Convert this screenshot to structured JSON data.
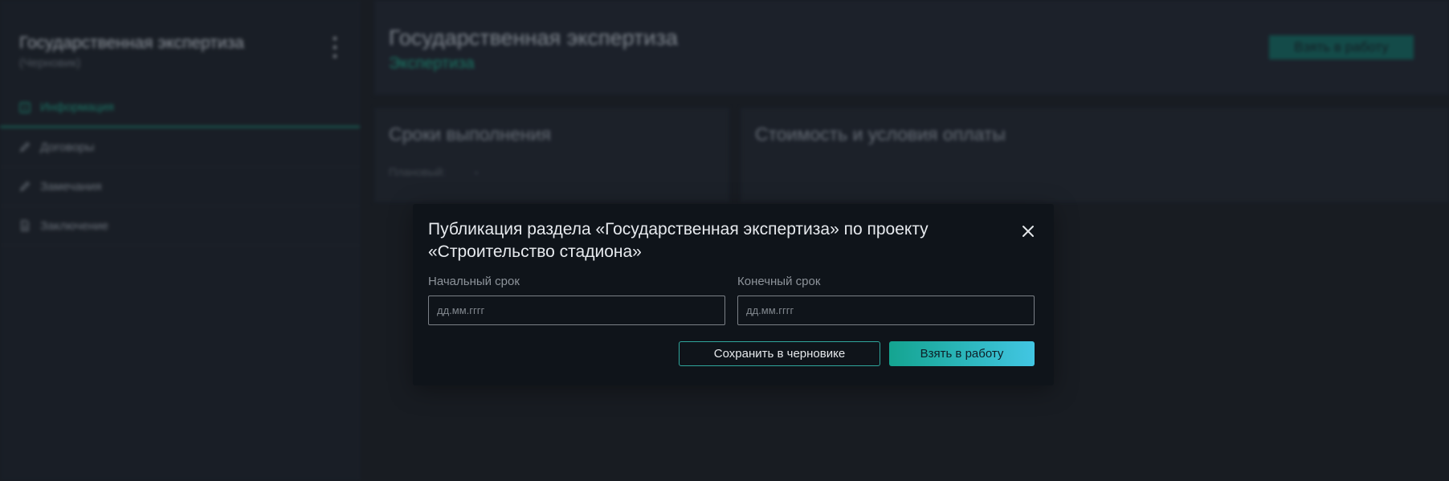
{
  "sidebar": {
    "title": "Государственная экспертиза",
    "subtitle": "(Черновик)",
    "items": [
      {
        "label": "Информация",
        "icon": "info-icon"
      },
      {
        "label": "Договоры",
        "icon": "pencil-icon"
      },
      {
        "label": "Замечания",
        "icon": "pencil-icon"
      },
      {
        "label": "Заключение",
        "icon": "document-icon"
      }
    ]
  },
  "header": {
    "title": "Государственная экспертиза",
    "subtitle": "Экспертиза",
    "action_label": "Взять в работу"
  },
  "cards": {
    "deadlines": {
      "title": "Сроки выполнения",
      "row_label": "Плановый:",
      "row_value": "-"
    },
    "cost": {
      "title": "Стоимость и условия оплаты"
    }
  },
  "modal": {
    "title": "Публикация раздела «Государственная экспертиза» по проекту «Строительство стадиона»",
    "start": {
      "label": "Начальный срок",
      "placeholder": "дд.мм.гггг",
      "value": ""
    },
    "end": {
      "label": "Конечный срок",
      "placeholder": "дд.мм.гггг",
      "value": ""
    },
    "save_label": "Сохранить в черновике",
    "take_label": "Взять в работу"
  },
  "colors": {
    "accent": "#1e8f78",
    "modal_bg": "#0f141a",
    "gradient_start": "#14a490",
    "gradient_end": "#42c6e3"
  }
}
